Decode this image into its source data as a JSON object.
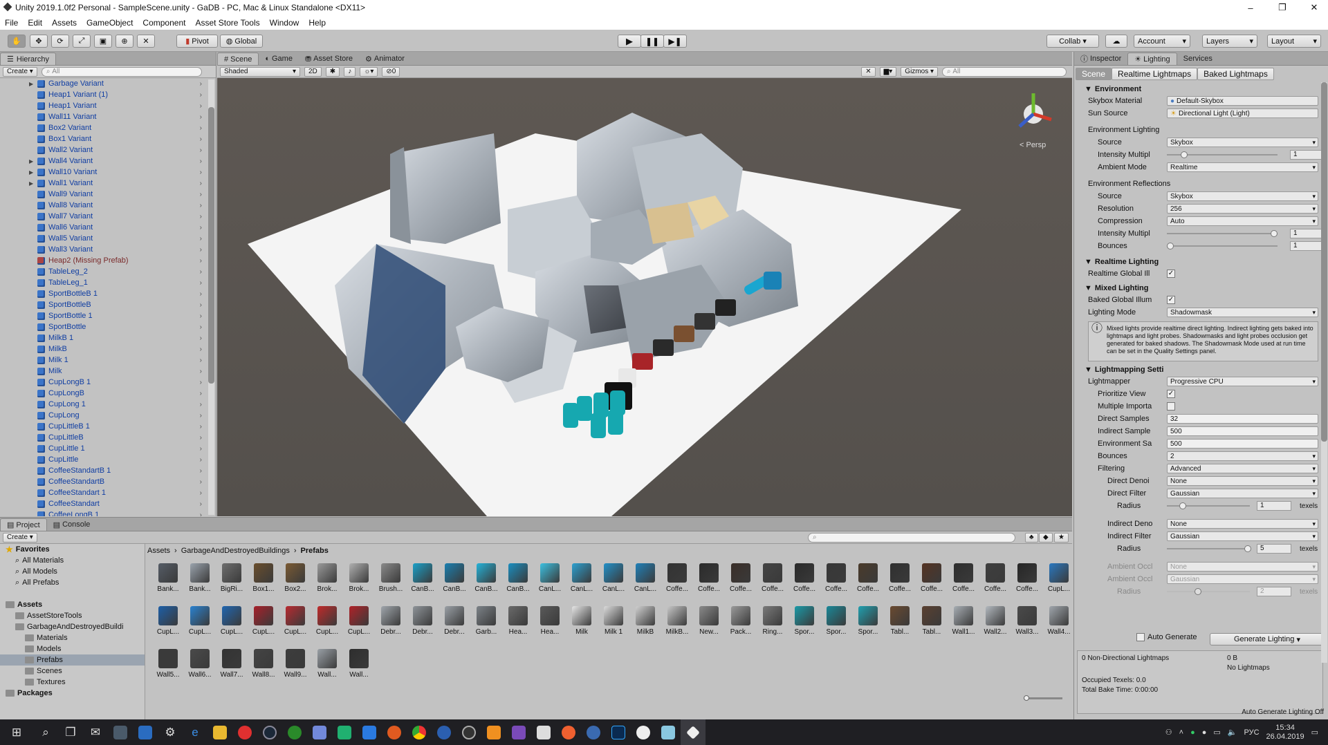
{
  "window": {
    "title": "Unity 2019.1.0f2 Personal - SampleScene.unity - GaDB - PC, Mac & Linux Standalone <DX11>",
    "minimize": "–",
    "maximize": "❐",
    "close": "✕"
  },
  "menu": [
    "File",
    "Edit",
    "Assets",
    "GameObject",
    "Component",
    "Asset Store Tools",
    "Window",
    "Help"
  ],
  "toolbar": {
    "pivot": "Pivot",
    "global": "Global",
    "collab": "Collab ▾",
    "account": "Account",
    "layers": "Layers",
    "layout": "Layout"
  },
  "hierarchy": {
    "tab": "Hierarchy",
    "create": "Create ▾",
    "search_placeholder": "All",
    "items": [
      {
        "label": "Garbage Variant",
        "arrow": true
      },
      {
        "label": "Heap1 Variant (1)",
        "arrow": false
      },
      {
        "label": "Heap1 Variant",
        "arrow": false
      },
      {
        "label": "Wall11 Variant",
        "arrow": false
      },
      {
        "label": "Box2 Variant",
        "arrow": false
      },
      {
        "label": "Box1 Variant",
        "arrow": false
      },
      {
        "label": "Wall2 Variant",
        "arrow": false
      },
      {
        "label": "Wall4 Variant",
        "arrow": true
      },
      {
        "label": "Wall10 Variant",
        "arrow": true
      },
      {
        "label": "Wall1 Variant",
        "arrow": true
      },
      {
        "label": "Wall9 Variant",
        "arrow": false
      },
      {
        "label": "Wall8 Variant",
        "arrow": false
      },
      {
        "label": "Wall7 Variant",
        "arrow": false
      },
      {
        "label": "Wall6 Variant",
        "arrow": false
      },
      {
        "label": "Wall5 Variant",
        "arrow": false
      },
      {
        "label": "Wall3 Variant",
        "arrow": false
      },
      {
        "label": "Heap2 (Missing Prefab)",
        "arrow": false,
        "missing": true
      },
      {
        "label": "TableLeg_2",
        "arrow": false
      },
      {
        "label": "TableLeg_1",
        "arrow": false
      },
      {
        "label": "SportBottleB 1",
        "arrow": false
      },
      {
        "label": "SportBottleB",
        "arrow": false
      },
      {
        "label": "SportBottle 1",
        "arrow": false
      },
      {
        "label": "SportBottle",
        "arrow": false
      },
      {
        "label": "MilkB 1",
        "arrow": false
      },
      {
        "label": "MilkB",
        "arrow": false
      },
      {
        "label": "Milk 1",
        "arrow": false
      },
      {
        "label": "Milk",
        "arrow": false
      },
      {
        "label": "CupLongB 1",
        "arrow": false
      },
      {
        "label": "CupLongB",
        "arrow": false
      },
      {
        "label": "CupLong 1",
        "arrow": false
      },
      {
        "label": "CupLong",
        "arrow": false
      },
      {
        "label": "CupLittleB 1",
        "arrow": false
      },
      {
        "label": "CupLittleB",
        "arrow": false
      },
      {
        "label": "CupLittle 1",
        "arrow": false
      },
      {
        "label": "CupLittle",
        "arrow": false
      },
      {
        "label": "CoffeeStandartB 1",
        "arrow": false
      },
      {
        "label": "CoffeeStandartB",
        "arrow": false
      },
      {
        "label": "CoffeeStandart 1",
        "arrow": false
      },
      {
        "label": "CoffeeStandart",
        "arrow": false
      },
      {
        "label": "CoffeeLongB 1",
        "arrow": false
      }
    ]
  },
  "scene": {
    "tabs": [
      "Scene",
      "Game",
      "Asset Store",
      "Animator"
    ],
    "shading": "Shaded",
    "mode2d": "2D",
    "gizmos": "Gizmos ▾",
    "search_placeholder": "All",
    "persp": "< Persp",
    "hidden_count": "0"
  },
  "inspector": {
    "tabs": [
      "Inspector",
      "Lighting",
      "Services"
    ],
    "subtabs": [
      "Scene",
      "Realtime Lightmaps",
      "Baked Lightmaps"
    ],
    "environment": {
      "header": "Environment",
      "skybox_label": "Skybox Material",
      "skybox_value": "Default-Skybox",
      "sun_label": "Sun Source",
      "sun_value": "Directional Light (Light)",
      "env_lighting": "Environment Lighting",
      "source_label": "Source",
      "source_value": "Skybox",
      "intensity_label": "Intensity Multipl",
      "intensity_value": "1",
      "ambient_label": "Ambient Mode",
      "ambient_value": "Realtime",
      "env_reflections": "Environment Reflections",
      "refl_source_value": "Skybox",
      "resolution_label": "Resolution",
      "resolution_value": "256",
      "compression_label": "Compression",
      "compression_value": "Auto",
      "refl_intensity_value": "1",
      "bounces_label": "Bounces",
      "bounces_value": "1"
    },
    "realtime": {
      "header": "Realtime Lighting",
      "gi_label": "Realtime Global Ill"
    },
    "mixed": {
      "header": "Mixed Lighting",
      "baked_label": "Baked Global Illum",
      "mode_label": "Lighting Mode",
      "mode_value": "Shadowmask",
      "info": "Mixed lights provide realtime direct lighting. Indirect lighting gets baked into lightmaps and light probes. Shadowmasks and light probes occlusion get generated for baked shadows. The Shadowmask Mode used at run time can be set in the Quality Settings panel."
    },
    "lightmapping": {
      "header": "Lightmapping Setti",
      "lightmapper_label": "Lightmapper",
      "lightmapper_value": "Progressive CPU",
      "prioritize_label": "Prioritize View",
      "multiple_label": "Multiple Importa",
      "direct_label": "Direct Samples",
      "direct_value": "32",
      "indirect_label": "Indirect Sample",
      "indirect_value": "500",
      "env_label": "Environment Sa",
      "env_value": "500",
      "bounces_label": "Bounces",
      "bounces_value": "2",
      "filtering_label": "Filtering",
      "filtering_value": "Advanced",
      "dir_denoiser_label": "Direct Denoi",
      "dir_denoiser_value": "None",
      "dir_filter_label": "Direct Filter",
      "dir_filter_value": "Gaussian",
      "radius_label": "Radius",
      "dir_radius_value": "1",
      "texels": "texels",
      "ind_denoiser_label": "Indirect Deno",
      "ind_denoiser_value": "None",
      "ind_filter_label": "Indirect Filter",
      "ind_filter_value": "Gaussian",
      "ind_radius_value": "5",
      "ao_denoiser_label": "Ambient Occl",
      "ao_denoiser_value": "None",
      "ao_filter_label": "Ambient Occl",
      "ao_filter_value": "Gaussian",
      "ao_radius_value": "2"
    },
    "auto_generate": "Auto Generate",
    "generate": "Generate Lighting",
    "stats": {
      "lightmaps": "0 Non-Directional Lightmaps",
      "size": "0 B",
      "none": "No Lightmaps",
      "texels": "Occupied Texels: 0.0",
      "time": "Total Bake Time: 0:00:00"
    },
    "status": "Auto Generate Lighting Off"
  },
  "project": {
    "tabs": [
      "Project",
      "Console"
    ],
    "create": "Create ▾",
    "breadcrumb": [
      "Assets",
      "GarbageAndDestroyedBuildings",
      "Prefabs"
    ],
    "tree": [
      {
        "label": "Favorites",
        "level": 0,
        "type": "star",
        "bold": true
      },
      {
        "label": "All Materials",
        "level": 1,
        "type": "search"
      },
      {
        "label": "All Models",
        "level": 1,
        "type": "search"
      },
      {
        "label": "All Prefabs",
        "level": 1,
        "type": "search"
      },
      {
        "label": "",
        "level": 0,
        "type": "gap"
      },
      {
        "label": "Assets",
        "level": 0,
        "type": "folder",
        "bold": true
      },
      {
        "label": "AssetStoreTools",
        "level": 1,
        "type": "folder"
      },
      {
        "label": "GarbageAndDestroyedBuildi",
        "level": 1,
        "type": "folder"
      },
      {
        "label": "Materials",
        "level": 2,
        "type": "folder"
      },
      {
        "label": "Models",
        "level": 2,
        "type": "folder"
      },
      {
        "label": "Prefabs",
        "level": 2,
        "type": "folder",
        "selected": true
      },
      {
        "label": "Scenes",
        "level": 2,
        "type": "folder"
      },
      {
        "label": "Textures",
        "level": 2,
        "type": "folder"
      },
      {
        "label": "Packages",
        "level": 0,
        "type": "folder",
        "bold": true
      }
    ],
    "assets": [
      {
        "label": "Bank...",
        "color": "#555c66"
      },
      {
        "label": "Bank...",
        "color": "#9aa3ad"
      },
      {
        "label": "BigRi...",
        "color": "#6e6e6e"
      },
      {
        "label": "Box1...",
        "color": "#6a4e2c"
      },
      {
        "label": "Box2...",
        "color": "#7a5a33"
      },
      {
        "label": "Brok...",
        "color": "#9a9a9a"
      },
      {
        "label": "Brok...",
        "color": "#b0b0b0"
      },
      {
        "label": "Brush...",
        "color": "#8a8a8a"
      },
      {
        "label": "CanB...",
        "color": "#1aa0c8"
      },
      {
        "label": "CanB...",
        "color": "#1a7fb0"
      },
      {
        "label": "CanB...",
        "color": "#24b2d8"
      },
      {
        "label": "CanB...",
        "color": "#1a8ec0"
      },
      {
        "label": "CanL...",
        "color": "#3cc0e0"
      },
      {
        "label": "CanL...",
        "color": "#2ca0d0"
      },
      {
        "label": "CanL...",
        "color": "#2290c8"
      },
      {
        "label": "CanL...",
        "color": "#2080b8"
      },
      {
        "label": "Coffe...",
        "color": "#333333"
      },
      {
        "label": "Coffe...",
        "color": "#2b2b2b"
      },
      {
        "label": "Coffe...",
        "color": "#3a2e28"
      },
      {
        "label": "Coffe...",
        "color": "#444444"
      },
      {
        "label": "Coffe...",
        "color": "#2a2a2a"
      },
      {
        "label": "Coffe...",
        "color": "#383838"
      },
      {
        "label": "Coffe...",
        "color": "#4a3a2a"
      },
      {
        "label": "Coffe...",
        "color": "#303030"
      },
      {
        "label": "Coffe...",
        "color": "#553322"
      },
      {
        "label": "Coffe...",
        "color": "#2e2e2e"
      },
      {
        "label": "Coffe...",
        "color": "#3e3e3e"
      },
      {
        "label": "Coffe...",
        "color": "#262626"
      },
      {
        "label": "CupL...",
        "color": "#2a78c0"
      },
      {
        "label": "CupL...",
        "color": "#1d5fa8"
      },
      {
        "label": "CupL...",
        "color": "#2a82d0"
      },
      {
        "label": "CupL...",
        "color": "#2066b0"
      },
      {
        "label": "CupL...",
        "color": "#a8202a"
      },
      {
        "label": "CupL...",
        "color": "#b82a30"
      },
      {
        "label": "CupL...",
        "color": "#c02a2a"
      },
      {
        "label": "CupL...",
        "color": "#b02228"
      },
      {
        "label": "Debr...",
        "color": "#a0a6ac"
      },
      {
        "label": "Debr...",
        "color": "#8e9499"
      },
      {
        "label": "Debr...",
        "color": "#9aa0a6"
      },
      {
        "label": "Garb...",
        "color": "#7c8288"
      },
      {
        "label": "Hea...",
        "color": "#6a6a6a"
      },
      {
        "label": "Hea...",
        "color": "#5a5a5a"
      },
      {
        "label": "Milk",
        "color": "#e6e6e6"
      },
      {
        "label": "Milk 1",
        "color": "#dcdcdc"
      },
      {
        "label": "MilkB",
        "color": "#d0d0d0"
      },
      {
        "label": "MilkB...",
        "color": "#c6c6c6"
      },
      {
        "label": "New...",
        "color": "#8a8a8a"
      },
      {
        "label": "Pack...",
        "color": "#9a9a9a"
      },
      {
        "label": "Ring...",
        "color": "#7a7a7a"
      },
      {
        "label": "Spor...",
        "color": "#1a9aa8"
      },
      {
        "label": "Spor...",
        "color": "#1a8898"
      },
      {
        "label": "Spor...",
        "color": "#20a0b0"
      },
      {
        "label": "Tabl...",
        "color": "#6a4a30"
      },
      {
        "label": "Tabl...",
        "color": "#5a4030"
      },
      {
        "label": "Wall1...",
        "color": "#a8aeb4"
      },
      {
        "label": "Wall2...",
        "color": "#b2b8be"
      },
      {
        "label": "Wall3...",
        "color": "#4a4a4a"
      },
      {
        "label": "Wall4...",
        "color": "#a0a6ac"
      },
      {
        "label": "Wall5...",
        "color": "#3a3a3a"
      },
      {
        "label": "Wall6...",
        "color": "#4a4a4a"
      },
      {
        "label": "Wall7...",
        "color": "#333333"
      },
      {
        "label": "Wall8...",
        "color": "#444444"
      },
      {
        "label": "Wall9...",
        "color": "#3c3c3c"
      },
      {
        "label": "Wall...",
        "color": "#9aa0a6"
      },
      {
        "label": "Wall...",
        "color": "#2e2e2e"
      }
    ]
  },
  "taskbar": {
    "lang": "РУС",
    "time": "15:34",
    "date": "26.04.2019"
  }
}
